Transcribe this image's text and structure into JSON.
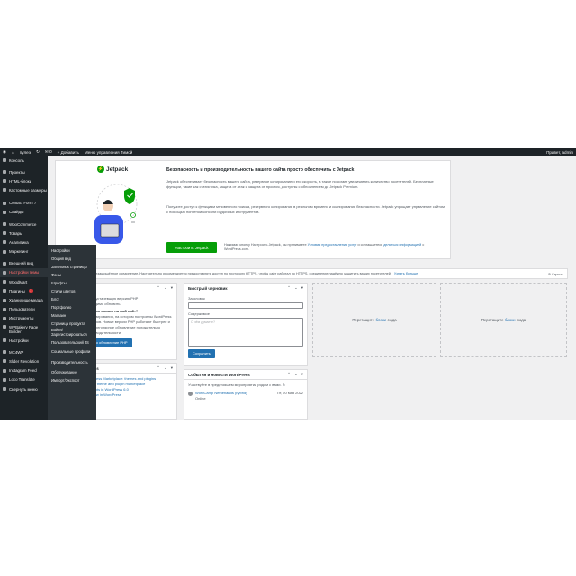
{
  "admin_bar": {
    "wp_logo_icon": "wordpress-icon",
    "site_name": "пулеэ",
    "updates_icon": "refresh-icon",
    "comments_count": "0",
    "new_label": "+ Добавить",
    "extra_label": "Меню управления Тимой",
    "user_greeting": "Привет, admin"
  },
  "sidebar": {
    "items": [
      {
        "label": "Консоль",
        "icon": "dashboard-icon"
      },
      {
        "label": "Проекты",
        "icon": "portfolio-icon"
      },
      {
        "label": "HTML-блоки",
        "icon": "html-icon"
      },
      {
        "label": "Кастомные размеры",
        "icon": "layout-icon"
      },
      {
        "label": "Contact Form 7",
        "icon": "mail-icon"
      },
      {
        "label": "Слайды",
        "icon": "slides-icon"
      },
      {
        "label": "WooCommerce",
        "icon": "woocommerce-icon"
      },
      {
        "label": "Товары",
        "icon": "products-icon"
      },
      {
        "label": "Аналитика",
        "icon": "analytics-icon"
      },
      {
        "label": "Маркетинг",
        "icon": "megaphone-icon"
      },
      {
        "label": "Внешний вид",
        "icon": "appearance-icon"
      },
      {
        "label": "Настройки темы",
        "icon": "theme-settings-icon"
      },
      {
        "label": "WoodMart",
        "icon": "woodmart-icon"
      },
      {
        "label": "Плагины",
        "icon": "plugins-icon",
        "badge": "1"
      },
      {
        "label": "Хранилище медиа",
        "icon": "media-icon"
      },
      {
        "label": "Пользователи",
        "icon": "users-icon"
      },
      {
        "label": "Инструменты",
        "icon": "tools-icon"
      },
      {
        "label": "WPBakery Page Builder",
        "icon": "wpbakery-icon"
      },
      {
        "label": "Настройки",
        "icon": "settings-icon"
      },
      {
        "label": "MC4WP",
        "icon": "mc4wp-icon"
      },
      {
        "label": "Slider Revolution",
        "icon": "slider-icon"
      },
      {
        "label": "Instagram Feed",
        "icon": "instagram-icon"
      },
      {
        "label": "Loco Translate",
        "icon": "translate-icon"
      },
      {
        "label": "Свернуть меню",
        "icon": "collapse-icon"
      }
    ]
  },
  "flyout": {
    "items": [
      "Настройки",
      "Общий вид",
      "Заголовок страницы",
      "Фоны",
      "Шрифты",
      "Стили цветов",
      "Блог",
      "Портфолио",
      "Магазин",
      "Страница продукта",
      "Войти/ Зарегистрироваться",
      "Пользовательский JS",
      "Социальные профили",
      "Производительность",
      "Обслуживание",
      "Импорт/Экспорт"
    ]
  },
  "jetpack": {
    "logo_text": "Jetpack",
    "title": "Безопасность и производительность вашего сайта просто обеспечить с Jetpack",
    "para1": "Jetpack обеспечивает безопасность вашего сайта, резервное копирование и его скорость, а также помогает увеличивать количество посетителей. Бесплатные функции, такие как статистика, защита от атак и защита от простоя, доступны с обновлением до Jetpack Premium.",
    "para2": "Получите доступ к функциям мгновенного поиска, резервного копирования в реальном времени и сканирования безопасности. Jetpack упрощает управление сайтом с помощью понятной консоли и удобных инструментов.",
    "button": "Настроить Jetpack",
    "terms_pre": "Нажимая кнопку Настроить Jetpack, вы принимаете",
    "terms_link1": "Условия предоставления услуг",
    "terms_mid": "и соглашаетесь",
    "terms_link2": "делиться информацией",
    "terms_post": "с WordPress.com."
  },
  "notice": {
    "text": "Ваш сайт использует незащищённое соединение. Настоятельно рекомендуется предоставлять доступ по протоколу HTTPS, чтобы сайт работал по HTTPS, соединение надёжно защитить ваших посетителей.",
    "link": "Узнать больше",
    "close": "Скрыть"
  },
  "php_box": {
    "title": "Обновление PHP",
    "line1": "Ваш сайт использует устаревшую версию PHP",
    "line2": "(7.3), которую необходимо обновить.",
    "heading": "Что такое PHP и как он влияет на мой сайт?",
    "body": "PHP — язык программирования, на котором построены WordPress и большинство плагинов. Новые версии PHP работают быстрее и безопаснее, поэтому регулярное обновление положительно сказывается на производительности.",
    "button": "Узнайте больше про обновление PHP"
  },
  "news_box": {
    "title": "Новости WordPress",
    "items": [
      "Introducing the WordPress Marketplace: themes and plugins",
      "Introducing WordPress theme and plugin marketplace",
      "Gutenberg improvements in WordPress 6.0",
      "WP Briefing: What's new in WordPress"
    ]
  },
  "quick_draft": {
    "title": "Быстрый черновик",
    "title_label": "Заголовок",
    "content_label": "Содержимое",
    "content_placeholder": "О чём думаете?",
    "button": "Сохранить"
  },
  "events": {
    "title": "События и новости WordPress",
    "attend": "Участвуйте в предстоящем мероприятии рядом с вами.",
    "event_name": "WordCamp Netherlands (hybrid)",
    "event_place": "Online",
    "event_date": "Пт, 20 мая 2022"
  },
  "drop1": {
    "pre": "Перетащите",
    "link": "блоки",
    "post": "сюда"
  },
  "drop2": {
    "pre": "Перетащите",
    "link": "блоки",
    "post": "сюда"
  },
  "screen_options": "Настройки экрана"
}
